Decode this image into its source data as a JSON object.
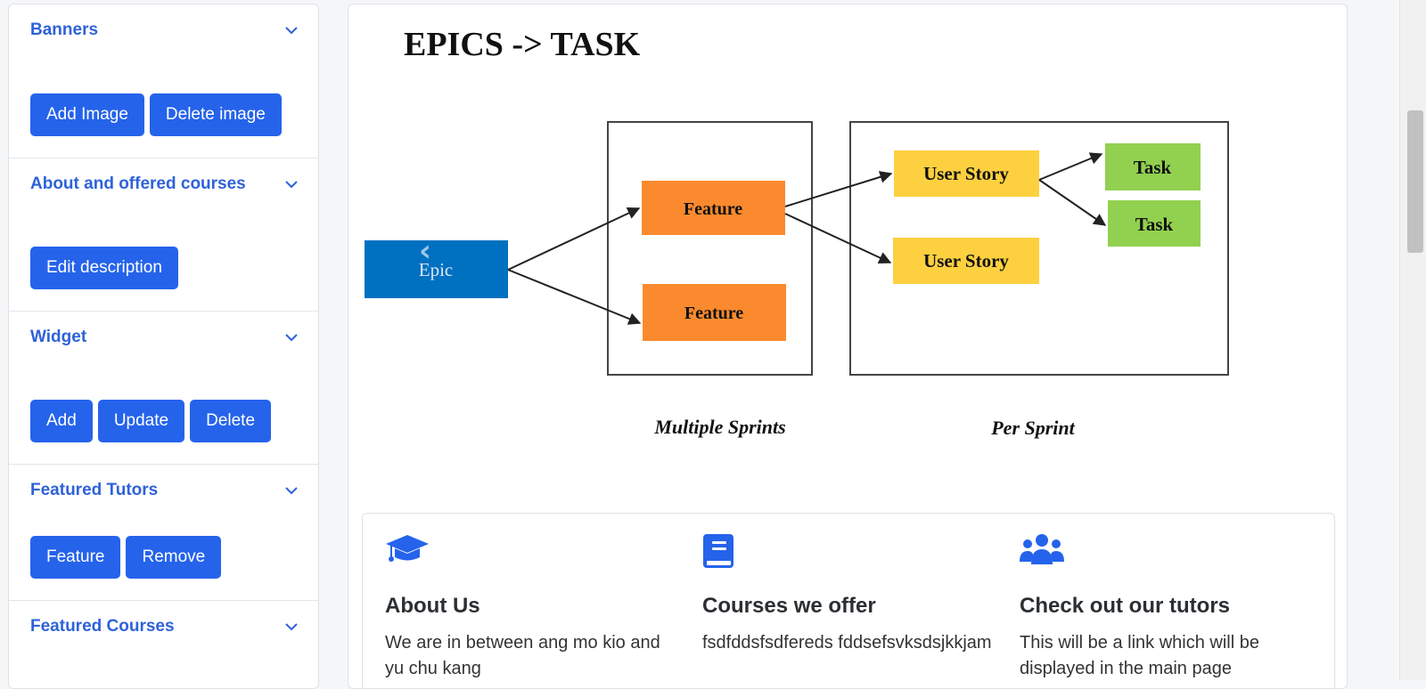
{
  "sidebar": {
    "sections": [
      {
        "title": "Banners",
        "buttons": [
          "Add Image",
          "Delete image"
        ]
      },
      {
        "title": "About and offered courses",
        "buttons": [
          "Edit description"
        ]
      },
      {
        "title": "Widget",
        "buttons": [
          "Add",
          "Update",
          "Delete"
        ]
      },
      {
        "title": "Featured Tutors",
        "buttons": [
          "Feature",
          "Remove"
        ]
      },
      {
        "title": "Featured Courses",
        "buttons": []
      }
    ]
  },
  "banner": {
    "heading": "EPICS -> TASK",
    "epic": "Epic",
    "feature": "Feature",
    "user_story": "User Story",
    "task": "Task",
    "multiple_sprints": "Multiple Sprints",
    "per_sprint": "Per Sprint",
    "carousel_prev": "‹"
  },
  "cards": [
    {
      "icon": "graduation-cap-icon",
      "title": "About Us",
      "text": "We are in between ang mo kio and yu chu kang"
    },
    {
      "icon": "book-icon",
      "title": "Courses we offer",
      "text": "fsdfddsfsdfereds fddsefsvksdsjkkjam"
    },
    {
      "icon": "users-icon",
      "title": "Check out our tutors",
      "text": "This will be a link which will be displayed in the main page"
    }
  ],
  "colors": {
    "accent": "#2563eb",
    "link": "#2f62d9",
    "epic": "#0070c0",
    "feature": "#fb8a2e",
    "user_story": "#fdd040",
    "task": "#92d050"
  }
}
